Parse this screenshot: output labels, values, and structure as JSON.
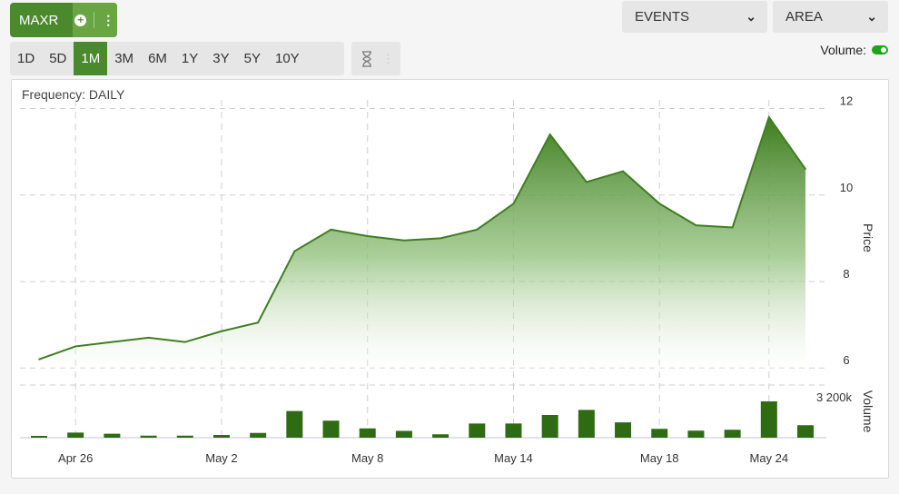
{
  "ticker": {
    "symbol": "MAXR"
  },
  "ranges": [
    {
      "label": "1D",
      "active": false
    },
    {
      "label": "5D",
      "active": false
    },
    {
      "label": "1M",
      "active": true
    },
    {
      "label": "3M",
      "active": false
    },
    {
      "label": "6M",
      "active": false
    },
    {
      "label": "1Y",
      "active": false
    },
    {
      "label": "3Y",
      "active": false
    },
    {
      "label": "5Y",
      "active": false
    },
    {
      "label": "10Y",
      "active": false
    }
  ],
  "events_label": "EVENTS",
  "charttype_label": "AREA",
  "volume_label": "Volume:",
  "colors": {
    "accent": "#4b8a2c",
    "line": "#3f7d22",
    "bar": "#2e6b12"
  },
  "chart_data": {
    "type": "area",
    "frequency_label": "Frequency: DAILY",
    "ylabel": "Price",
    "y2label": "Volume",
    "ylim": [
      5.9,
      12.2
    ],
    "yticks": [
      6,
      8,
      10,
      12
    ],
    "volume_tick_label": "3 200k",
    "volume_max_k": 4000,
    "xticks": [
      {
        "label": "Apr 26",
        "index": 1
      },
      {
        "label": "May 2",
        "index": 5
      },
      {
        "label": "May 8",
        "index": 9
      },
      {
        "label": "May 14",
        "index": 13
      },
      {
        "label": "May 18",
        "index": 17
      },
      {
        "label": "May 24",
        "index": 20
      }
    ],
    "series": [
      {
        "values": [
          6.2,
          6.5,
          6.6,
          6.7,
          6.6,
          6.85,
          7.05,
          8.7,
          9.2,
          9.05,
          8.95,
          9.0,
          9.2,
          9.8,
          11.4,
          10.3,
          10.55,
          9.8,
          9.3,
          9.25,
          11.8,
          10.6
        ]
      }
    ],
    "volume_k": [
      100,
      450,
      350,
      180,
      180,
      240,
      420,
      2350,
      1500,
      820,
      600,
      300,
      1250,
      1250,
      2000,
      2450,
      1350,
      780,
      620,
      700,
      3200,
      1100
    ]
  }
}
